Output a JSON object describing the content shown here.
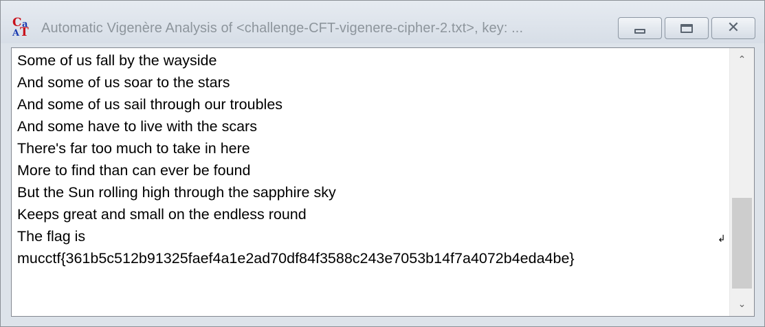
{
  "window": {
    "title": "Automatic Vigenère Analysis of <challenge-CFT-vigenere-cipher-2.txt>, key: ...",
    "icon_letters": [
      "C",
      "a",
      "A",
      "T"
    ]
  },
  "controls": {
    "minimize_icon": "minimize-icon",
    "maximize_icon": "maximize-icon",
    "close_icon": "close-icon",
    "close_glyph": "✕"
  },
  "document": {
    "lines": [
      "Some of us fall by the wayside",
      "And some of us soar to the stars",
      "And some of us sail through our troubles",
      "And some have to live with the scars",
      "There's far too much to take in here",
      "More to find than can ever be found",
      "But the Sun rolling high through the sapphire sky",
      "Keeps great and small on the endless round",
      "The flag is",
      "mucctf{361b5c512b91325faef4a1e2ad70df84f3588c243e7053b14f7a4072b4eda4be}"
    ],
    "paragraph_mark": "↲"
  },
  "scrollbar": {
    "up_glyph": "⌃",
    "down_glyph": "⌄"
  }
}
